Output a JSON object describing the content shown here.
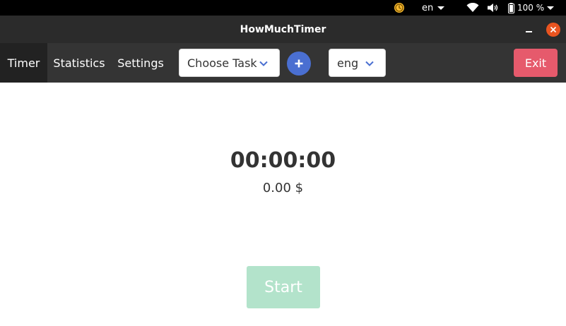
{
  "system_bar": {
    "language": "en",
    "battery": "100 %",
    "icons": [
      "clock-icon",
      "wifi-icon",
      "volume-icon",
      "battery-icon"
    ]
  },
  "window": {
    "title": "HowMuchTimer",
    "close_color": "#e95420"
  },
  "nav": {
    "tabs": [
      {
        "label": "Timer",
        "active": true
      },
      {
        "label": "Statistics",
        "active": false
      },
      {
        "label": "Settings",
        "active": false
      }
    ],
    "task_select": {
      "value": "Choose Task"
    },
    "add_task_icon": "plus-icon",
    "language_select": {
      "value": "eng"
    },
    "exit_label": "Exit"
  },
  "main": {
    "timer": "00:00:00",
    "amount": "0.00 $",
    "start_label": "Start"
  },
  "colors": {
    "accent_blue": "#4a6fd1",
    "exit_red": "#e65a6c",
    "start_green": "#b3e3cb",
    "nav_bg": "#343434",
    "active_tab_bg": "#222222"
  }
}
